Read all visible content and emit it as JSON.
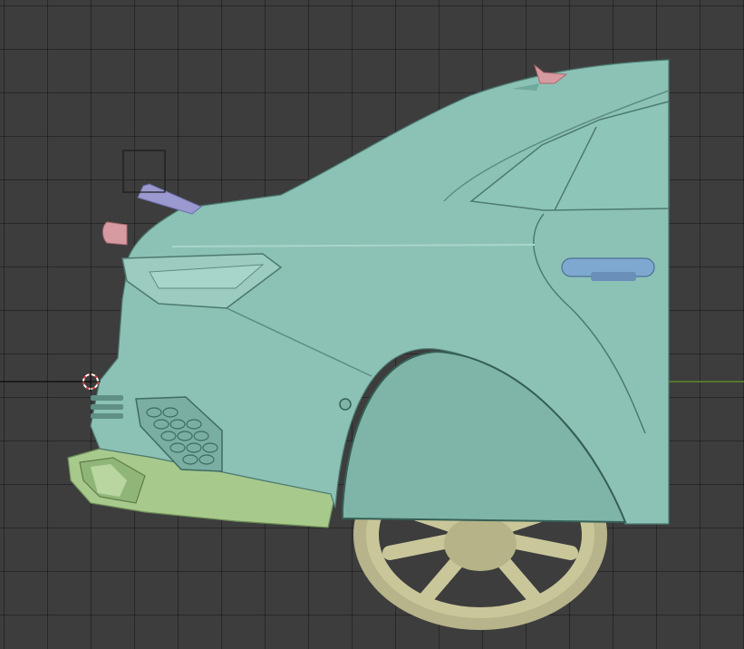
{
  "viewport": {
    "mode": "3D viewport",
    "background_color": "#3d3d3d",
    "grid_color": "#2f2f2f",
    "x_axis_color": "#5c8a2a"
  },
  "model": {
    "body_color": "#8cc2b6",
    "body_shadow_color": "#6fa89c",
    "trim_color": "#a7c98c",
    "wheel_color": "#c9c79a",
    "tire_color": "#b7b38a",
    "accent_pink": "#d79aa0",
    "accent_purple": "#9a9ad0"
  },
  "gizmos": {
    "cursor_icon": "3d-cursor-icon",
    "selection_box_icon": "selection-box-icon"
  }
}
